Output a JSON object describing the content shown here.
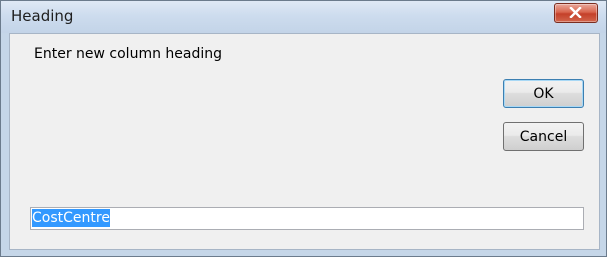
{
  "window": {
    "title": "Heading"
  },
  "dialog": {
    "prompt": "Enter new column heading",
    "ok_label": "OK",
    "cancel_label": "Cancel",
    "input_value": "CostCentre"
  },
  "icons": {
    "close": "close-icon"
  },
  "colors": {
    "titlebar": "#cddcee",
    "close_button": "#c4402a",
    "selection": "#3399ff"
  }
}
